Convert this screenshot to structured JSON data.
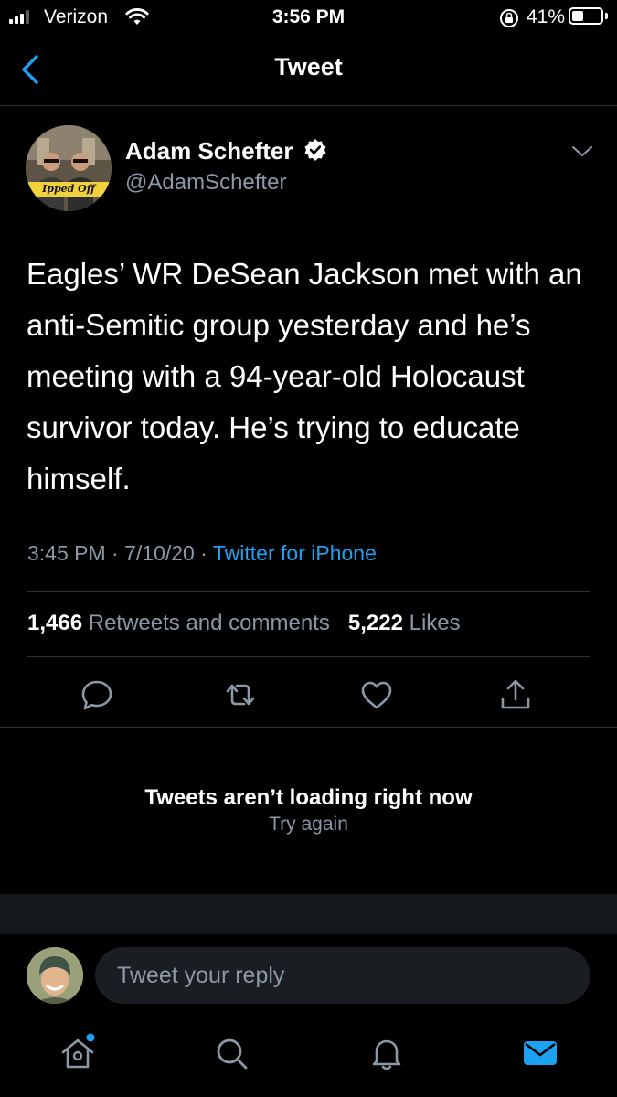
{
  "status_bar": {
    "carrier": "Verizon",
    "time": "3:56 PM",
    "battery_percent": "41%",
    "battery_level": 0.41
  },
  "nav": {
    "title": "Tweet"
  },
  "tweet": {
    "author_name": "Adam Schefter",
    "author_handle": "@AdamSchefter",
    "avatar_caption": "Ipped Off",
    "text": "Eagles’ WR DeSean Jackson met with an anti-Semitic group yesterday and he’s meeting with a 94-year-old Holocaust survivor today. He’s trying to educate himself.",
    "time": "3:45 PM",
    "date": "7/10/20",
    "source": "Twitter for iPhone",
    "retweet_count": "1,466",
    "retweet_label": "Retweets and comments",
    "like_count": "5,222",
    "like_label": "Likes"
  },
  "error": {
    "title": "Tweets aren’t loading right now",
    "retry": "Try again"
  },
  "reply": {
    "placeholder": "Tweet your reply"
  },
  "icons": {
    "actions": [
      "reply-icon",
      "retweet-icon",
      "like-icon",
      "share-icon"
    ],
    "tabs": [
      "home-icon",
      "search-icon",
      "notifications-icon",
      "messages-icon"
    ]
  },
  "colors": {
    "accent": "#1da1f2",
    "muted": "#8b98a5",
    "background": "#000000"
  }
}
